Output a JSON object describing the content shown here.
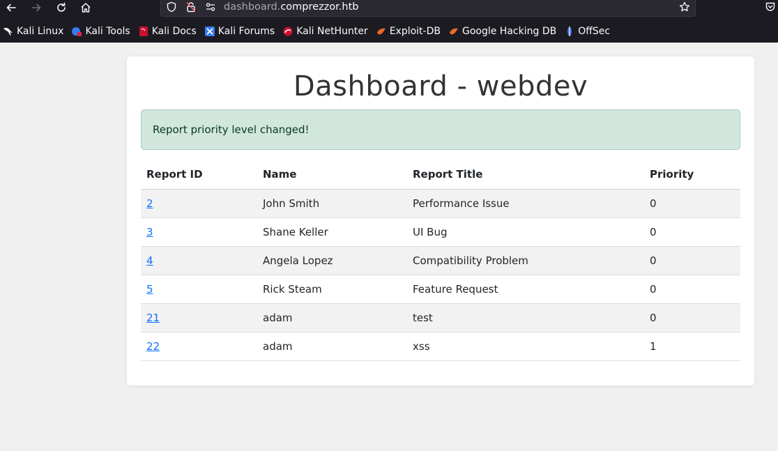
{
  "browser": {
    "url_host_prefix": "dashboard.",
    "url_host_main": "comprezzor.htb",
    "bookmarks": [
      {
        "label": "Kali Linux",
        "icon": "kali-dragon-icon"
      },
      {
        "label": "Kali Tools",
        "icon": "kali-tools-icon"
      },
      {
        "label": "Kali Docs",
        "icon": "kali-docs-icon"
      },
      {
        "label": "Kali Forums",
        "icon": "kali-forums-icon"
      },
      {
        "label": "Kali NetHunter",
        "icon": "kali-nethunter-icon"
      },
      {
        "label": "Exploit-DB",
        "icon": "exploit-db-icon"
      },
      {
        "label": "Google Hacking DB",
        "icon": "ghdb-icon"
      },
      {
        "label": "OffSec",
        "icon": "offsec-icon"
      }
    ]
  },
  "page": {
    "title": "Dashboard - webdev",
    "alert": "Report priority level changed!"
  },
  "table": {
    "headers": [
      "Report ID",
      "Name",
      "Report Title",
      "Priority"
    ],
    "rows": [
      {
        "id": "2",
        "name": "John Smith",
        "title": "Performance Issue",
        "priority": "0"
      },
      {
        "id": "3",
        "name": "Shane Keller",
        "title": "UI Bug",
        "priority": "0"
      },
      {
        "id": "4",
        "name": "Angela Lopez",
        "title": "Compatibility Problem",
        "priority": "0"
      },
      {
        "id": "5",
        "name": "Rick Steam",
        "title": "Feature Request",
        "priority": "0"
      },
      {
        "id": "21",
        "name": "adam",
        "title": "test",
        "priority": "0"
      },
      {
        "id": "22",
        "name": "adam",
        "title": "xss",
        "priority": "1"
      }
    ]
  },
  "colors": {
    "chrome_bg": "#1c1b22",
    "alert_bg": "#d1e7dd",
    "link": "#0d6efd"
  }
}
